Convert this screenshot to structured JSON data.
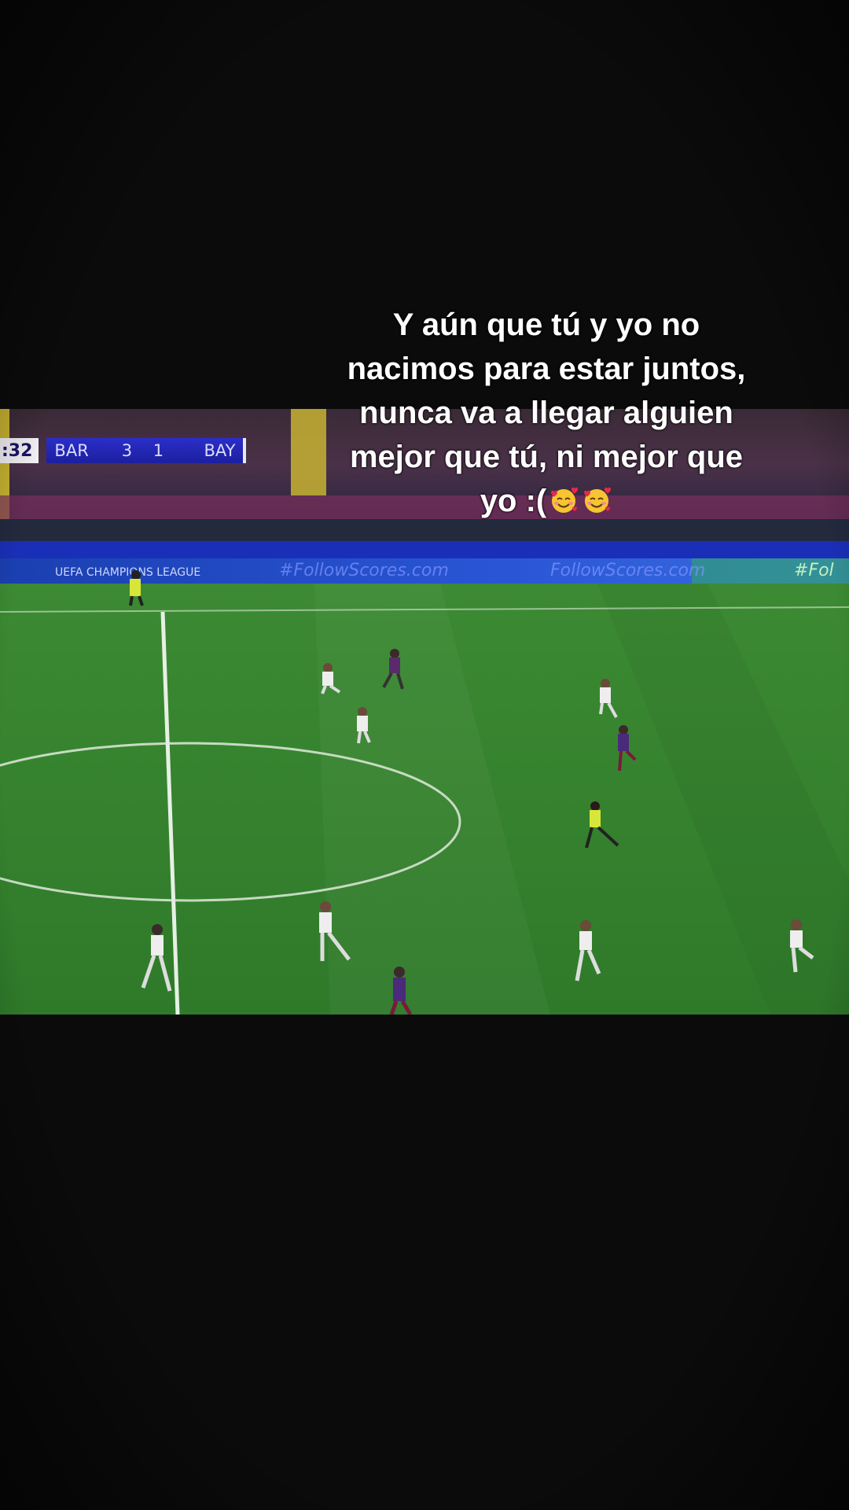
{
  "caption": {
    "line1": "Y aún que tú y yo no",
    "line2": "nacimos para estar juntos,",
    "line3": "nunca va a llegar alguien",
    "line4": "mejor que tú, ni mejor que",
    "line5": "yo :(",
    "emoji": "smiling-face-with-hearts-icon"
  },
  "scoreboard": {
    "clock": ":32",
    "home_team": "BAR",
    "home_score": "3",
    "away_score": "1",
    "away_team": "BAY"
  },
  "video": {
    "board_texts": [
      "UEFA CHAMPIONS LEAGUE",
      "#FollowScores.com",
      "FollowScores.com",
      "#Fol"
    ]
  },
  "colors": {
    "background": "#0b0b0b",
    "pitch": "#2e7d2a",
    "scoreboard_blue": "#2b2ec9",
    "caption_text": "#ffffff"
  }
}
